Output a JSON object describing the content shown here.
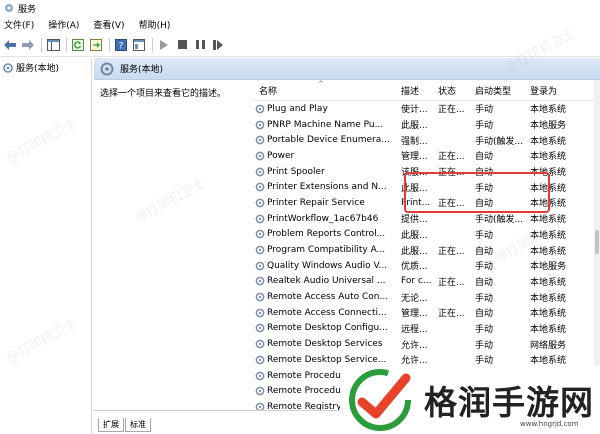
{
  "window": {
    "title": "服务"
  },
  "menu": [
    "文件(F)",
    "操作(A)",
    "查看(V)",
    "帮助(H)"
  ],
  "toolbar": [
    "back-icon",
    "forward-icon",
    "show-tree-icon",
    "refresh-icon",
    "export-icon",
    "help-icon",
    "properties-icon",
    "start-icon",
    "stop-icon",
    "pause-icon",
    "restart-icon"
  ],
  "tree": {
    "root_label": "服务(本地)"
  },
  "pane": {
    "title": "服务(本地)",
    "description_prompt": "选择一个项目来查看它的描述。"
  },
  "columns": {
    "name": "名称",
    "desc": "描述",
    "status": "状态",
    "startup": "启动类型",
    "logon": "登录为"
  },
  "services": [
    {
      "name": "Plug and Play",
      "desc": "使计...",
      "status": "正在...",
      "startup": "手动",
      "logon": "本地系统"
    },
    {
      "name": "PNRP Machine Name Pu...",
      "desc": "此服...",
      "status": "",
      "startup": "手动",
      "logon": "本地服务"
    },
    {
      "name": "Portable Device Enumera...",
      "desc": "强制...",
      "status": "",
      "startup": "手动(触发...",
      "logon": "本地系统"
    },
    {
      "name": "Power",
      "desc": "管理...",
      "status": "正在...",
      "startup": "自动",
      "logon": "本地系统"
    },
    {
      "name": "Print Spooler",
      "desc": "该服...",
      "status": "正在...",
      "startup": "自动",
      "logon": "本地系统"
    },
    {
      "name": "Printer Extensions and N...",
      "desc": "此服...",
      "status": "",
      "startup": "手动",
      "logon": "本地系统"
    },
    {
      "name": "Printer Repair Service",
      "desc": "Print...",
      "status": "正在...",
      "startup": "自动",
      "logon": "本地系统"
    },
    {
      "name": "PrintWorkflow_1ac67b46",
      "desc": "提供...",
      "status": "",
      "startup": "手动(触发...",
      "logon": "本地系统"
    },
    {
      "name": "Problem Reports Control...",
      "desc": "此服...",
      "status": "",
      "startup": "手动",
      "logon": "本地系统"
    },
    {
      "name": "Program Compatibility A...",
      "desc": "此服...",
      "status": "正在...",
      "startup": "自动",
      "logon": "本地系统"
    },
    {
      "name": "Quality Windows Audio V...",
      "desc": "优质...",
      "status": "",
      "startup": "手动",
      "logon": "本地服务"
    },
    {
      "name": "Realtek Audio Universal ...",
      "desc": "For c...",
      "status": "正在...",
      "startup": "自动",
      "logon": "本地系统"
    },
    {
      "name": "Remote Access Auto Con...",
      "desc": "无论...",
      "status": "",
      "startup": "手动",
      "logon": "本地系统"
    },
    {
      "name": "Remote Access Connecti...",
      "desc": "管理...",
      "status": "正在...",
      "startup": "自动",
      "logon": "本地系统"
    },
    {
      "name": "Remote Desktop Configu...",
      "desc": "远程...",
      "status": "",
      "startup": "手动",
      "logon": "本地系统"
    },
    {
      "name": "Remote Desktop Services",
      "desc": "允许...",
      "status": "",
      "startup": "手动",
      "logon": "网络服务"
    },
    {
      "name": "Remote Desktop Service...",
      "desc": "允许...",
      "status": "",
      "startup": "手动",
      "logon": "本地系统"
    },
    {
      "name": "Remote Procedur...",
      "desc": "",
      "status": "",
      "startup": "",
      "logon": ""
    },
    {
      "name": "Remote Procedur...",
      "desc": "",
      "status": "",
      "startup": "",
      "logon": ""
    },
    {
      "name": "Remote Registry",
      "desc": "",
      "status": "",
      "startup": "",
      "logon": ""
    }
  ],
  "tabs": [
    "扩展",
    "标准"
  ],
  "watermark": "@打印机卫士",
  "logo": {
    "text": "格润手游网",
    "url": "www.hngrjd.com"
  },
  "colors": {
    "highlight": "#e23b3b",
    "header_blue": "#c9dbef",
    "logo_green": "#2a9d3a"
  }
}
